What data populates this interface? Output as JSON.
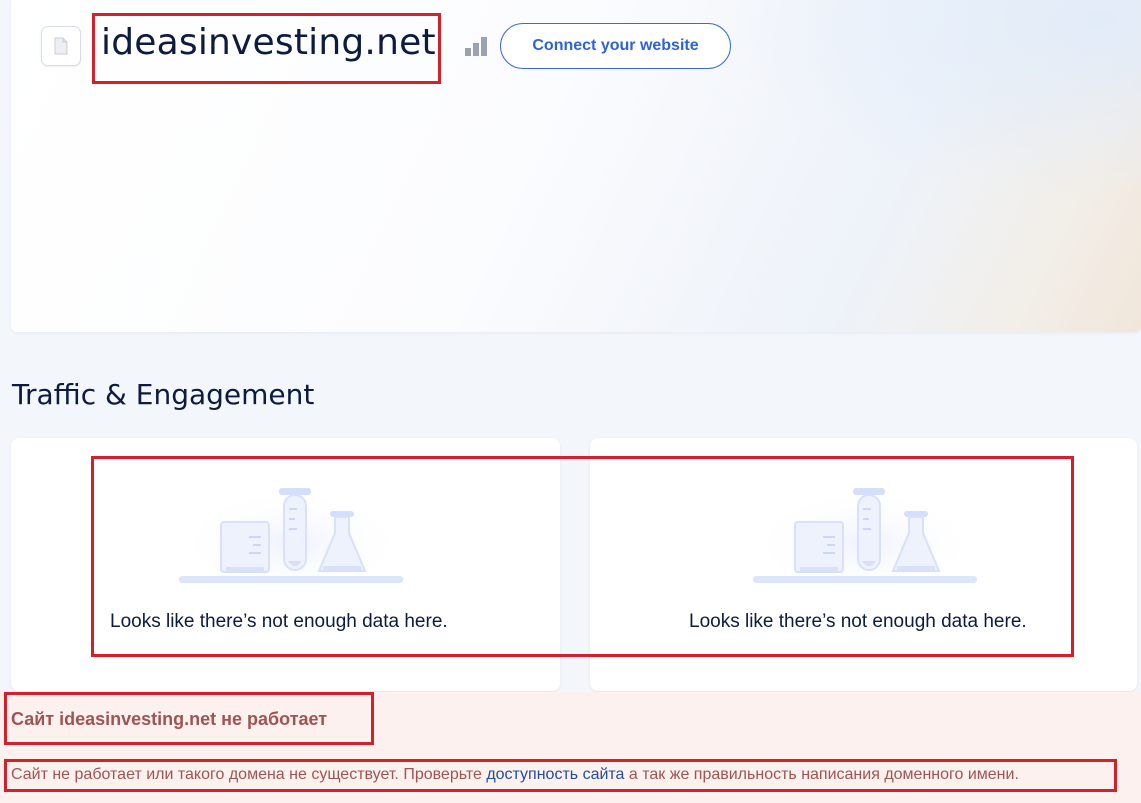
{
  "header": {
    "site_name": "ideasinvesting.net",
    "connect_button": "Connect your website"
  },
  "traffic": {
    "section_title": "Traffic & Engagement",
    "panels": [
      {
        "empty_message": "Looks like there’s not enough data here."
      },
      {
        "empty_message": "Looks like there’s not enough data here."
      }
    ]
  },
  "error": {
    "title": "Сайт ideasinvesting.net не работает",
    "desc_before": "Сайт не работает или такого домена не существует. Проверьте ",
    "link_text": "доступность сайта",
    "desc_after": " а так же правильность написания доменного имени."
  },
  "colors": {
    "highlight": "#d4202a",
    "accent": "#2d63d6",
    "error_text": "#a05452"
  },
  "icons": {
    "favicon": "document-icon",
    "rank": "signal-bars-icon",
    "empty_state": "lab-flasks-icon"
  }
}
